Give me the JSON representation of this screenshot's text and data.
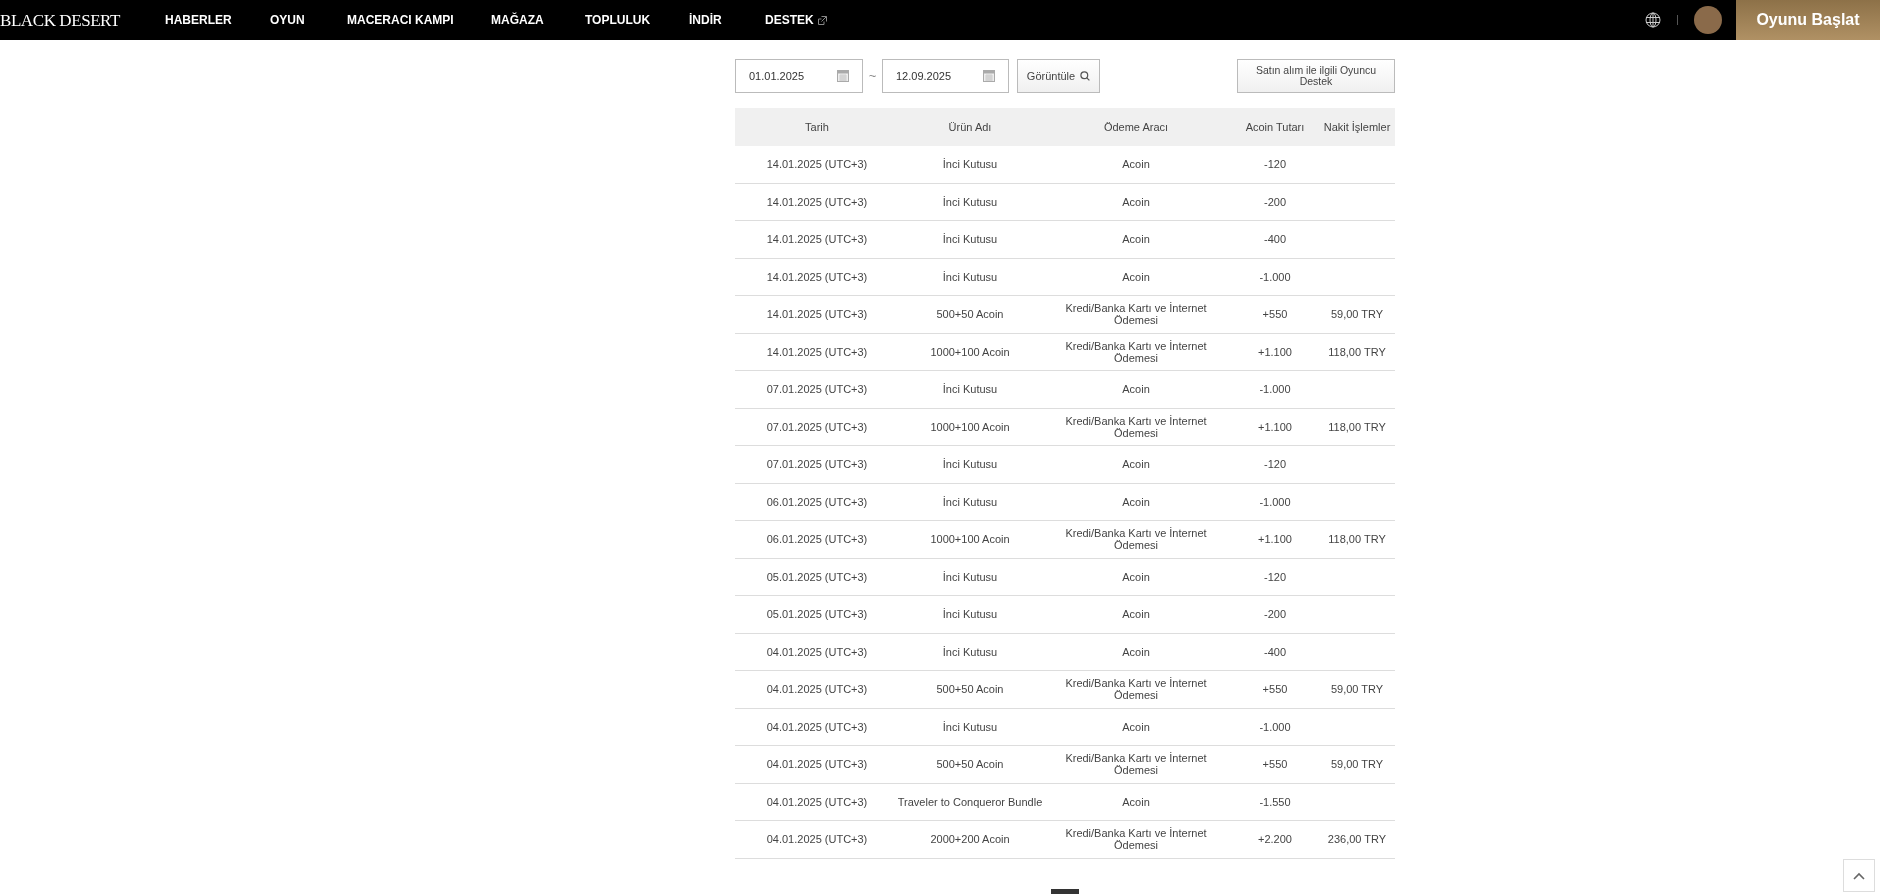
{
  "header": {
    "logo": "BLACK DESERT",
    "nav": [
      {
        "label": "HABERLER",
        "external": false
      },
      {
        "label": "OYUN",
        "external": false
      },
      {
        "label": "MACERACI KAMPI",
        "external": false
      },
      {
        "label": "MAĞAZA",
        "external": false
      },
      {
        "label": "TOPLULUK",
        "external": false
      },
      {
        "label": "İNDİR",
        "external": false
      },
      {
        "label": "DESTEK",
        "external": true
      }
    ],
    "start_button": "Oyunu Başlat"
  },
  "filters": {
    "start_date": "01.01.2025",
    "separator": "~",
    "end_date": "12.09.2025",
    "view_button": "Görüntüle",
    "support_button": "Satın alım ile ilgili Oyuncu Destek"
  },
  "table": {
    "columns": [
      "Tarih",
      "Ürün Adı",
      "Ödeme Aracı",
      "Acoin Tutarı",
      "Nakit İşlemler"
    ],
    "rows": [
      [
        "14.01.2025 (UTC+3)",
        "İnci Kutusu",
        "Acoin",
        "-120",
        ""
      ],
      [
        "14.01.2025 (UTC+3)",
        "İnci Kutusu",
        "Acoin",
        "-200",
        ""
      ],
      [
        "14.01.2025 (UTC+3)",
        "İnci Kutusu",
        "Acoin",
        "-400",
        ""
      ],
      [
        "14.01.2025 (UTC+3)",
        "İnci Kutusu",
        "Acoin",
        "-1.000",
        ""
      ],
      [
        "14.01.2025 (UTC+3)",
        "500+50 Acoin",
        "Kredi/Banka Kartı ve İnternet Ödemesi",
        "+550",
        "59,00 TRY"
      ],
      [
        "14.01.2025 (UTC+3)",
        "1000+100 Acoin",
        "Kredi/Banka Kartı ve İnternet Ödemesi",
        "+1.100",
        "118,00 TRY"
      ],
      [
        "07.01.2025 (UTC+3)",
        "İnci Kutusu",
        "Acoin",
        "-1.000",
        ""
      ],
      [
        "07.01.2025 (UTC+3)",
        "1000+100 Acoin",
        "Kredi/Banka Kartı ve İnternet Ödemesi",
        "+1.100",
        "118,00 TRY"
      ],
      [
        "07.01.2025 (UTC+3)",
        "İnci Kutusu",
        "Acoin",
        "-120",
        ""
      ],
      [
        "06.01.2025 (UTC+3)",
        "İnci Kutusu",
        "Acoin",
        "-1.000",
        ""
      ],
      [
        "06.01.2025 (UTC+3)",
        "1000+100 Acoin",
        "Kredi/Banka Kartı ve İnternet Ödemesi",
        "+1.100",
        "118,00 TRY"
      ],
      [
        "05.01.2025 (UTC+3)",
        "İnci Kutusu",
        "Acoin",
        "-120",
        ""
      ],
      [
        "05.01.2025 (UTC+3)",
        "İnci Kutusu",
        "Acoin",
        "-200",
        ""
      ],
      [
        "04.01.2025 (UTC+3)",
        "İnci Kutusu",
        "Acoin",
        "-400",
        ""
      ],
      [
        "04.01.2025 (UTC+3)",
        "500+50 Acoin",
        "Kredi/Banka Kartı ve İnternet Ödemesi",
        "+550",
        "59,00 TRY"
      ],
      [
        "04.01.2025 (UTC+3)",
        "İnci Kutusu",
        "Acoin",
        "-1.000",
        ""
      ],
      [
        "04.01.2025 (UTC+3)",
        "500+50 Acoin",
        "Kredi/Banka Kartı ve İnternet Ödemesi",
        "+550",
        "59,00 TRY"
      ],
      [
        "04.01.2025 (UTC+3)",
        "Traveler to Conqueror Bundle",
        "Acoin",
        "-1.550",
        ""
      ],
      [
        "04.01.2025 (UTC+3)",
        "2000+200 Acoin",
        "Kredi/Banka Kartı ve İnternet Ödemesi",
        "+2.200",
        "236,00 TRY"
      ]
    ]
  }
}
